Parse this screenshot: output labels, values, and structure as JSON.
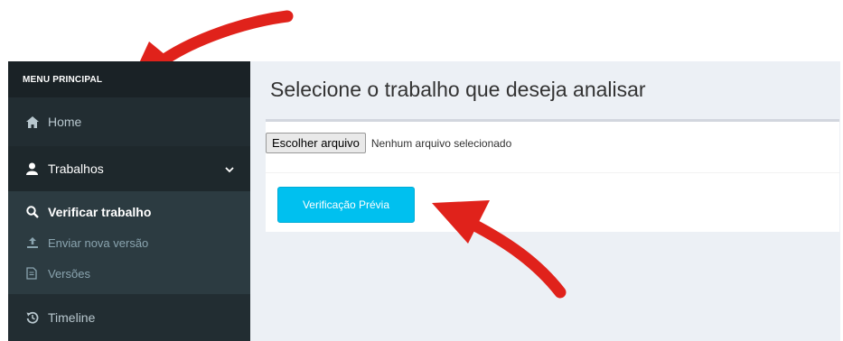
{
  "sidebar": {
    "header": "MENU PRINCIPAL",
    "items": [
      {
        "label": "Home",
        "icon": "home-icon"
      },
      {
        "label": "Trabalhos",
        "icon": "user-icon"
      },
      {
        "label": "Timeline",
        "icon": "history-icon"
      }
    ],
    "subitems": [
      {
        "label": "Verificar trabalho",
        "icon": "search-icon"
      },
      {
        "label": "Enviar nova versão",
        "icon": "upload-icon"
      },
      {
        "label": "Versões",
        "icon": "file-icon"
      }
    ]
  },
  "main": {
    "title": "Selecione o trabalho que deseja analisar",
    "file_button": "Escolher arquivo",
    "file_status": "Nenhum arquivo selecionado",
    "verify_button": "Verificação Prévia"
  },
  "colors": {
    "sidebar_bg": "#222d32",
    "sidebar_header_bg": "#1a2226",
    "submenu_bg": "#2c3b41",
    "content_bg": "#ecf0f5",
    "accent_button": "#00c0ef",
    "annotation_arrow": "#e0221b"
  }
}
